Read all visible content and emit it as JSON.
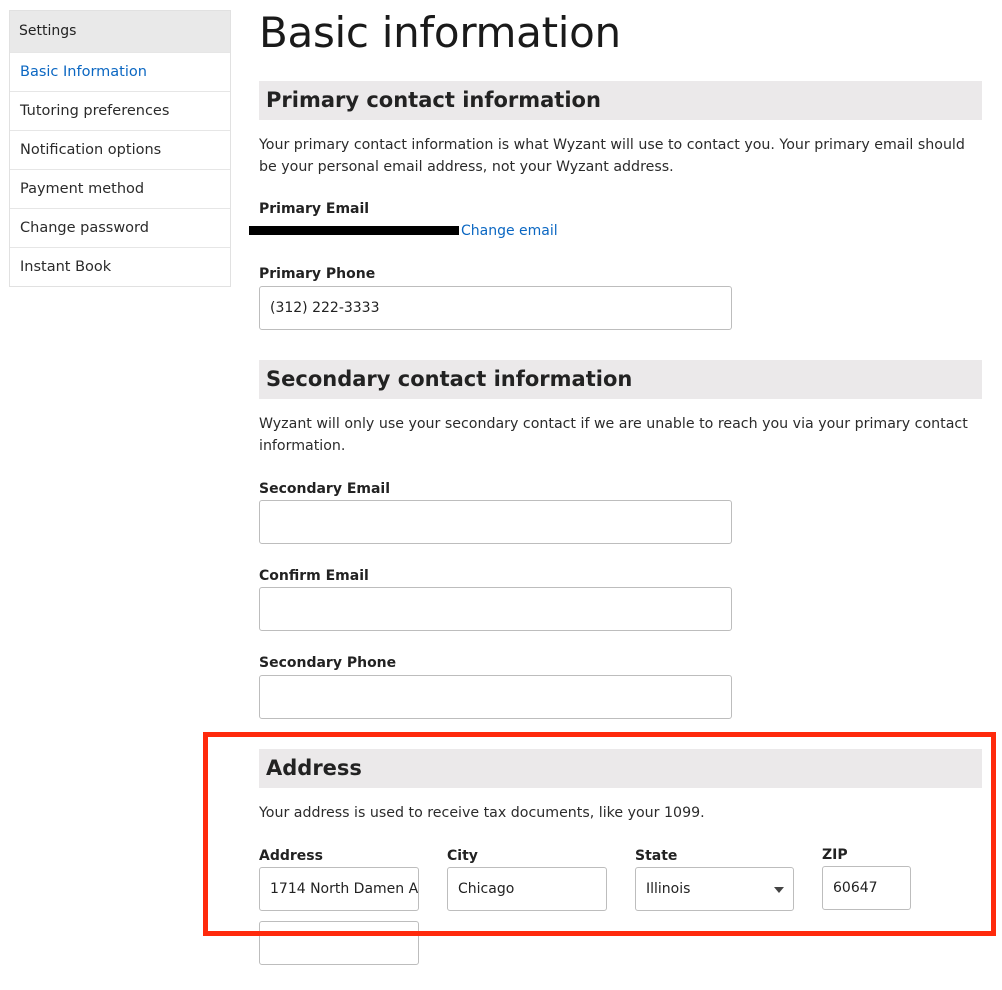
{
  "sidebar": {
    "header": "Settings",
    "items": [
      {
        "label": "Basic Information"
      },
      {
        "label": "Tutoring preferences"
      },
      {
        "label": "Notification options"
      },
      {
        "label": "Payment method"
      },
      {
        "label": "Change password"
      },
      {
        "label": "Instant Book"
      }
    ],
    "active_index": 0
  },
  "page": {
    "title": "Basic information"
  },
  "primary": {
    "heading": "Primary contact information",
    "description": "Your primary contact information is what Wyzant will use to contact you. Your primary email should be your personal email address, not your Wyzant address.",
    "email_label": "Primary Email",
    "change_email_link": "Change email",
    "phone_label": "Primary Phone",
    "phone_value": "(312) 222-3333"
  },
  "secondary": {
    "heading": "Secondary contact information",
    "description": "Wyzant will only use your secondary contact if we are unable to reach you via your primary contact information.",
    "email_label": "Secondary Email",
    "email_value": "",
    "confirm_label": "Confirm Email",
    "confirm_value": "",
    "phone_label": "Secondary Phone",
    "phone_value": ""
  },
  "address": {
    "heading": "Address",
    "description": "Your address is used to receive tax documents, like your 1099.",
    "address_label": "Address",
    "address_value": "1714 North Damen A",
    "address2_value": "",
    "city_label": "City",
    "city_value": "Chicago",
    "state_label": "State",
    "state_value": "Illinois",
    "zip_label": "ZIP",
    "zip_value": "60647"
  },
  "colors": {
    "accent_link": "#0b67c2",
    "section_heading_bg": "#ebe9ea",
    "highlight_border": "#ff2a0c"
  }
}
